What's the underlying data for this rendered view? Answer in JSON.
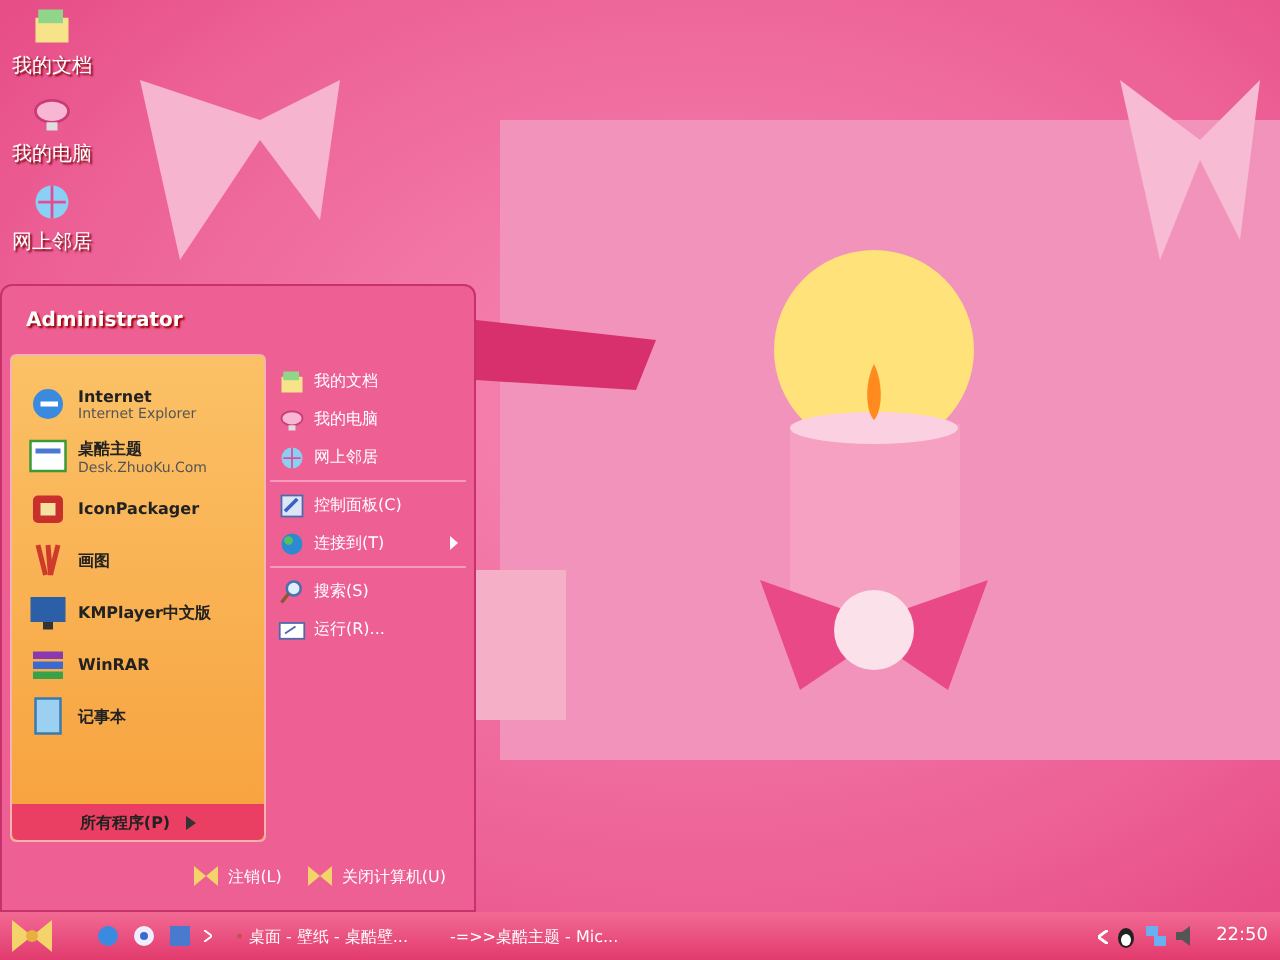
{
  "desktop_icons": [
    {
      "label": "我的文档",
      "kind": "docs"
    },
    {
      "label": "我的电脑",
      "kind": "computer"
    },
    {
      "label": "网上邻居",
      "kind": "network"
    }
  ],
  "start_menu": {
    "user": "Administrator",
    "pinned": [
      {
        "title": "Internet",
        "subtitle": "Internet Explorer",
        "kind": "ie"
      },
      {
        "title": "桌酷主题",
        "subtitle": "Desk.ZhuoKu.Com",
        "kind": "web"
      },
      {
        "title": "IconPackager",
        "kind": "box"
      },
      {
        "title": "画图",
        "kind": "paint"
      },
      {
        "title": "KMPlayer中文版",
        "kind": "monitor"
      },
      {
        "title": "WinRAR",
        "kind": "rar"
      },
      {
        "title": "记事本",
        "kind": "notepad"
      }
    ],
    "all_programs": "所有程序(P)",
    "places": [
      {
        "items": [
          {
            "label": "我的文档",
            "kind": "docs",
            "submenu": false
          },
          {
            "label": "我的电脑",
            "kind": "computer",
            "submenu": false
          },
          {
            "label": "网上邻居",
            "kind": "network",
            "submenu": false
          }
        ]
      },
      {
        "items": [
          {
            "label": "控制面板(C)",
            "kind": "panel",
            "submenu": false
          },
          {
            "label": "连接到(T)",
            "kind": "globe",
            "submenu": true
          }
        ]
      },
      {
        "items": [
          {
            "label": "搜索(S)",
            "kind": "search",
            "submenu": false
          },
          {
            "label": "运行(R)...",
            "kind": "run",
            "submenu": false
          }
        ]
      }
    ],
    "footer": [
      "注销(L)",
      "关闭计算机(U)"
    ]
  },
  "taskbar": {
    "tasks": [
      {
        "label": "桌面 - 壁纸 - 桌酷壁...",
        "kind": "chrome"
      },
      {
        "label": "-=>>桌酷主题 - Mic...",
        "kind": "word"
      }
    ],
    "clock": "22:50"
  }
}
